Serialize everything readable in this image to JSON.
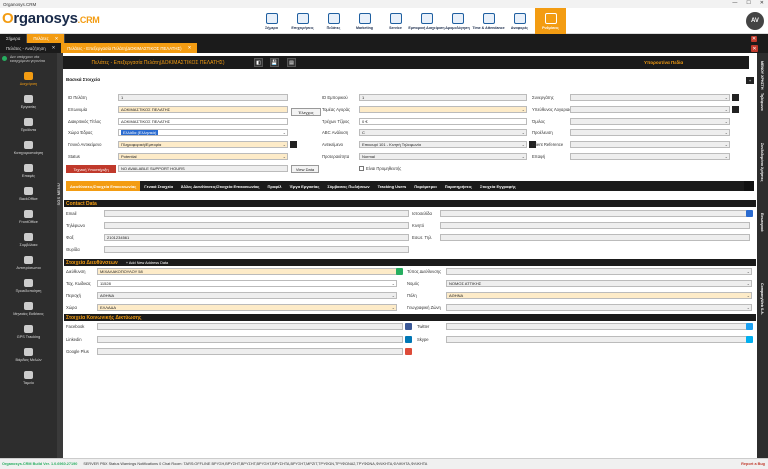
{
  "window": {
    "title": "Organosys.CRM",
    "controls": [
      "—",
      "☐",
      "✕"
    ]
  },
  "logo": {
    "o": "O",
    "rest": "rganosys",
    "crm": ".CRM"
  },
  "topnav": [
    {
      "label": "Σήμερα",
      "active": false
    },
    {
      "label": "Επιχειρήσεις",
      "active": false
    },
    {
      "label": "Πελάτες",
      "active": false
    },
    {
      "label": "Marketing",
      "active": false
    },
    {
      "label": "Service",
      "active": false
    },
    {
      "label": "Εμπορική Διαχείριση",
      "active": false
    },
    {
      "label": "Δρομολόγηση",
      "active": false
    },
    {
      "label": "Time & Attendance",
      "active": false
    },
    {
      "label": "Αναφορές",
      "active": false
    },
    {
      "label": "Ρυθμίσεις",
      "active": true
    }
  ],
  "avatar": {
    "initials": "AV"
  },
  "tabs1": [
    {
      "label": "Σήμερα",
      "active": false
    },
    {
      "label": "Πελάτες",
      "active": true,
      "close": "✕"
    }
  ],
  "tabs2": [
    {
      "label": "Πελάτες - Αναζήτηση",
      "active": false,
      "close": "✕"
    },
    {
      "label": "Πελάτες - Επεξεργασία Πελάτη(ΔΟΚΙΜΑΣΤΙΚΟΣ ΠΕΛΑΤΗΣ)",
      "active": true,
      "close": "✕"
    }
  ],
  "close_all": "✕",
  "sidebar": {
    "head": "Δεν υπάρχουν νέα εισερχόμενα γεγονότα",
    "items": [
      {
        "label": "Διαχείριση",
        "active": true
      },
      {
        "label": "Εργασίες",
        "active": false
      },
      {
        "label": "Προϊόντα",
        "active": false
      },
      {
        "label": "Κατηγοριοποίηση",
        "active": false
      },
      {
        "label": "Επαφές",
        "active": false
      },
      {
        "label": "BackOffice",
        "active": false
      },
      {
        "label": "FrontOffice",
        "active": false
      },
      {
        "label": "Συμβόλαια",
        "active": false
      },
      {
        "label": "Αντιπρόσωποι",
        "active": false
      },
      {
        "label": "Προειδοποίηση",
        "active": false
      },
      {
        "label": "Μηνιαίες Εκθέσεις",
        "active": false
      },
      {
        "label": "GPS Tracking",
        "active": false
      },
      {
        "label": "Βάρδιες Μελών",
        "active": false
      },
      {
        "label": "Ταμείο",
        "active": false
      }
    ]
  },
  "vstrip": "SOS MENU",
  "rstrip": [
    "ΜΕΝΟΥ ΧΡΗΣΤΗ",
    "Τηλέφωνα",
    "Συνδεδεμένοι Χρήστες",
    "Εσωτερικά",
    "CompanyWeb S.A."
  ],
  "form": {
    "title": "Πελάτες - Επεξεργασία Πελάτη(ΔΟΚΙΜΑΣΤΙΚΟΣ ΠΕΛΑΤΗΣ)",
    "buttons": [
      "◧",
      "💾",
      "▤"
    ],
    "task": "Υπορουτίνα Πεδία",
    "section": "Βασικά Στοιχεία",
    "topsq": "+",
    "col1": [
      {
        "label": "ID Πελάτη",
        "value": "1",
        "style": "gry"
      },
      {
        "label": "Επωνυμία",
        "value": "ΔΟΚΙΜΑΣΤΙΚΟΣ ΠΕΛΑΤΗΣ",
        "style": "yel"
      },
      {
        "label": "Διακριτικός Τίτλος",
        "value": "ΔΟΚΙΜΑΣΤΙΚΟΣ ΠΕΛΑΤΗΣ",
        "style": ""
      },
      {
        "label": "Χώρα Έδρας",
        "value": "Ελλάδα (Ελληνικά)",
        "style": "sel"
      },
      {
        "label": "Γενικό Αντικείμενο",
        "value": "Πληροφορική/Εμπορία",
        "style": "yel"
      },
      {
        "label": "Status",
        "value": "Potential",
        "style": "yel"
      },
      {
        "label": "Ομάδα Υποστήριξης",
        "value": "NO AVAILABLE SUPPORT HOURS",
        "style": "gry"
      }
    ],
    "viewbtn": "View Data",
    "checkbtn": "Έλεγχος",
    "col2": [
      {
        "label": "ID Εμπορικού",
        "value": "1",
        "style": "gry"
      },
      {
        "label": "Τομέας Αγοράς",
        "value": "",
        "style": "yel"
      },
      {
        "label": "Τρέχων Τζίρος",
        "value": "0 €",
        "style": ""
      },
      {
        "label": "ABC Ανάλυση",
        "value": "C",
        "style": "gry"
      },
      {
        "label": "Αντικείμενο",
        "value": "Επικουρί 101 - Κινητή Τηλεφωνία",
        "style": "gry"
      },
      {
        "label": "Προτεραιότητα",
        "value": "Normal",
        "style": "gry"
      }
    ],
    "check2": "Είναι Προμηθευτής",
    "col3": [
      {
        "label": "Συνεργάτης",
        "value": ""
      },
      {
        "label": "Υπεύθυνος Λογαριασμού",
        "value": ""
      },
      {
        "label": "Όμιλος",
        "value": ""
      },
      {
        "label": "Προέλευση",
        "value": ""
      },
      {
        "label": "Client Reference",
        "value": ""
      },
      {
        "label": "Επαφή",
        "value": ""
      }
    ],
    "techbtn": "Τεχνική Υποστήριξη"
  },
  "subtabs": [
    {
      "label": "Διευθύνσεις/Στοιχεία Επικοινωνίας",
      "active": true
    },
    {
      "label": "Γενικά Στοιχεία",
      "active": false
    },
    {
      "label": "Άλλες Διευθύνσεις/Στοιχεία Επικοινωνίας",
      "active": false
    },
    {
      "label": "Προφίλ",
      "active": false
    },
    {
      "label": "Έργα Εργασίας",
      "active": false
    },
    {
      "label": "Σύμβασεις Πωλήσεων",
      "active": false
    },
    {
      "label": "Tracking Users",
      "active": false
    },
    {
      "label": "Παράμετροι",
      "active": false
    },
    {
      "label": "Παρατηρήσεις",
      "active": false
    },
    {
      "label": "Στοιχεία Εγγραφής",
      "active": false
    }
  ],
  "contact": {
    "band": "Contact Data",
    "left": [
      {
        "label": "Email",
        "value": ""
      },
      {
        "label": "Τηλέφωνο",
        "value": ""
      },
      {
        "label": "Φαξ",
        "value": "2101234561"
      },
      {
        "label": "Θυρίδα",
        "value": ""
      }
    ],
    "right": [
      {
        "label": "Ιστοσελίδα",
        "value": ""
      },
      {
        "label": "Κινητό",
        "value": ""
      },
      {
        "label": "Εσωτ. Τηλ.",
        "value": ""
      }
    ]
  },
  "address": {
    "band": "Στοιχεία Διευθύνσεων",
    "addnew": "+ Add New Address Data",
    "left": [
      {
        "label": "Διεύθυνση",
        "value": "ΜΙΧΑΛΑΚΟΠΟΥΛΟΥ 58",
        "style": "yel"
      },
      {
        "label": "Ταχ. Κωδικας",
        "value": "11528",
        "style": ""
      },
      {
        "label": "Περιοχή",
        "value": "ΑΘΗΝΑ",
        "style": "gry"
      },
      {
        "label": "Χώρα",
        "value": "ΕΛΛΑΔΑ",
        "style": "yel"
      }
    ],
    "right": [
      {
        "label": "Τύπος Διεύθυνσης",
        "value": "",
        "style": "gry"
      },
      {
        "label": "Νομός",
        "value": "ΝΟΜΟΣ ΑΤΤΙΚΗΣ",
        "style": "gry"
      },
      {
        "label": "Πόλη",
        "value": "ΑΘΗΝΑ",
        "style": "yel"
      },
      {
        "label": "Γεωγραφική Ζώνη",
        "value": "",
        "style": "gry"
      }
    ]
  },
  "social": {
    "band": "Στοιχεία Κοινωνικής Δικτύωσης",
    "left": [
      {
        "label": "Facebook",
        "value": ""
      },
      {
        "label": "Linkedin",
        "value": ""
      },
      {
        "label": "Google Plus",
        "value": ""
      }
    ],
    "right": [
      {
        "label": "Twitter",
        "value": ""
      },
      {
        "label": "Skype",
        "value": ""
      }
    ]
  },
  "status": {
    "build": "Organosys.CRM Build Ver. 1.0.6960.27190",
    "items": "SERVER   PBX Status   Warnings   Notifications 0   Chat Room: TARS:OFFLINE   ΒΡΥΣΗ,ΒΡΥΣΗΤ,ΒΡΥΣΗΤ,ΒΡΥΣΗΤ,ΒΡΥΣΗΤΑ,ΒΡΥΣΗΤ,ΜΡΖΙΤ,ΤΡΥΦΩΝ,ΤΡΥΦΩΝΑ2,ΤΡΥΦΩΝΑ,ΦΛΙΚΗΤΑ,ΦΛΙΚΗΤΑ,ΦΛΙΚΗΤΑ",
    "report": "Report a Bug"
  }
}
